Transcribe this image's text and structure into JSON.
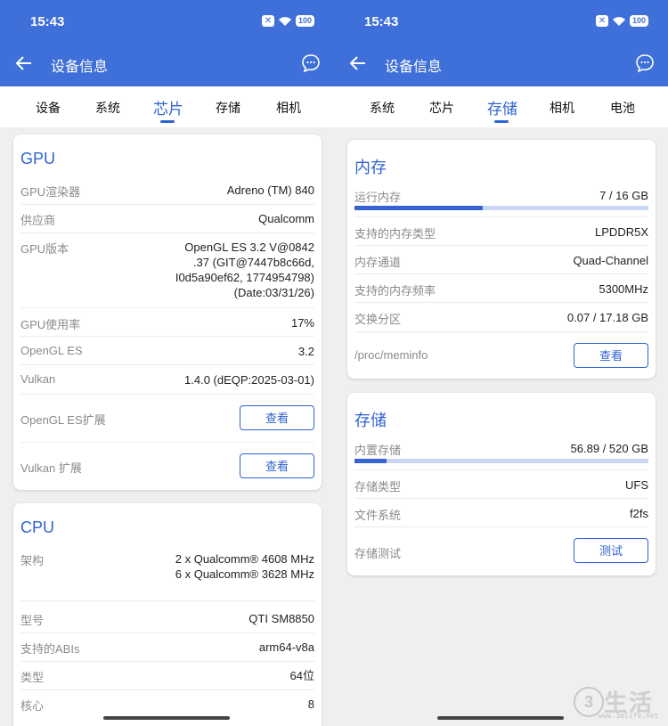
{
  "status": {
    "time": "15:43",
    "x_label": "✕",
    "battery": "100"
  },
  "header": {
    "title": "设备信息"
  },
  "left": {
    "tabs": [
      "设备",
      "系统",
      "芯片",
      "存储",
      "相机"
    ],
    "gpu": {
      "title": "GPU",
      "renderer": {
        "k": "GPU渲染器",
        "v": "Adreno (TM) 840"
      },
      "vendor": {
        "k": "供应商",
        "v": "Qualcomm"
      },
      "version": {
        "k": "GPU版本",
        "v1": "OpenGL ES 3.2 V@0842",
        "v2": ".37 (GIT@7447b8c66d,",
        "v3": "I0d5a90ef62, 1774954798)",
        "v4": "(Date:03/31/26)"
      },
      "usage": {
        "k": "GPU使用率",
        "v": "17%"
      },
      "opengl": {
        "k": "OpenGL ES",
        "v": "3.2"
      },
      "vulkan": {
        "k": "Vulkan",
        "v": "1.4.0 (dEQP:2025-03-01)"
      },
      "gl_ext": {
        "k": "OpenGL ES扩展",
        "btn": "查看"
      },
      "vk_ext": {
        "k": "Vulkan 扩展",
        "btn": "查看"
      }
    },
    "cpu": {
      "title": "CPU",
      "arch": {
        "k": "架构",
        "v1": "2 x Qualcomm® 4608 MHz",
        "v2": "6 x Qualcomm® 3628 MHz"
      },
      "model": {
        "k": "型号",
        "v": "QTI SM8850"
      },
      "abis": {
        "k": "支持的ABIs",
        "v": "arm64-v8a"
      },
      "type": {
        "k": "类型",
        "v": "64位"
      },
      "cores": {
        "k": "核心",
        "v": "8"
      }
    }
  },
  "right": {
    "tabs": [
      "系统",
      "芯片",
      "存储",
      "相机",
      "电池"
    ],
    "memory": {
      "title": "内存",
      "ram": {
        "k": "运行内存",
        "v": "7 / 16 GB",
        "fraction": 0.4375
      },
      "mem_type": {
        "k": "支持的内存类型",
        "v": "LPDDR5X"
      },
      "channel": {
        "k": "内存通道",
        "v": "Quad-Channel"
      },
      "freq": {
        "k": "支持的内存频率",
        "v": "5300MHz"
      },
      "swap": {
        "k": "交换分区",
        "v": "0.07 / 17.18 GB"
      },
      "meminfo": {
        "k": "/proc/meminfo",
        "btn": "查看"
      }
    },
    "storage": {
      "title": "存储",
      "internal": {
        "k": "内置存储",
        "v": "56.89 / 520 GB",
        "fraction": 0.1094
      },
      "type": {
        "k": "存储类型",
        "v": "UFS"
      },
      "fs": {
        "k": "文件系统",
        "v": "f2fs"
      },
      "test": {
        "k": "存储测试",
        "btn": "测试"
      }
    }
  },
  "watermark": {
    "circle": "3",
    "text": "生活",
    "url": "www.3elife.net"
  },
  "colors": {
    "header": "#3f6fd8",
    "accent": "#2f63d4",
    "bar_bg": "#c9d7f4"
  }
}
